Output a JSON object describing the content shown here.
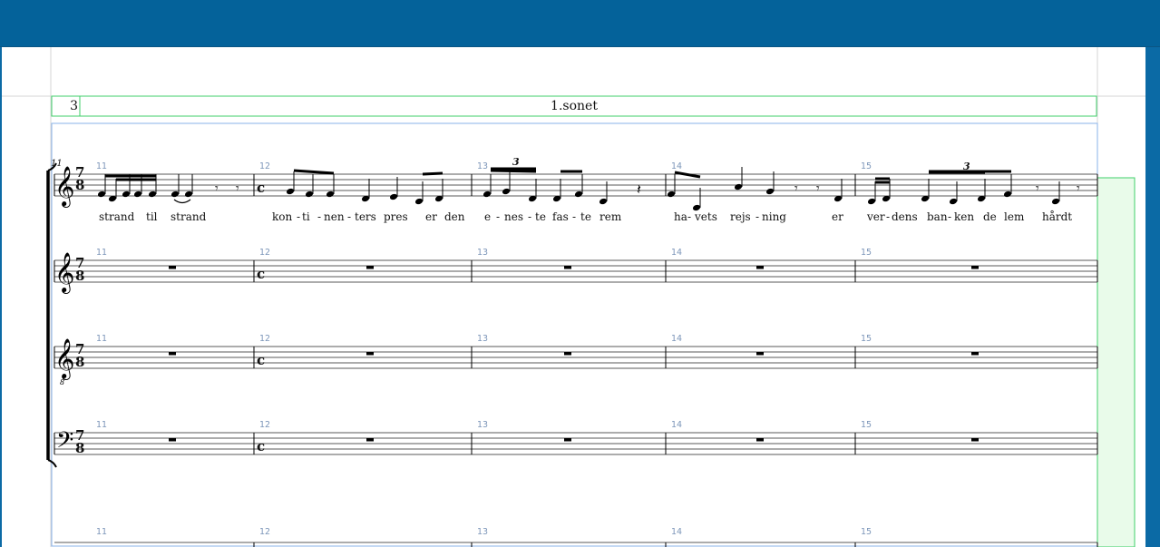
{
  "page_header": {
    "page_number": "3",
    "title": "1.sonet"
  },
  "system_start_number": "11",
  "measure_numbers": [
    "11",
    "12",
    "13",
    "14",
    "15"
  ],
  "time_signatures": {
    "first": {
      "num": "7",
      "den": "8"
    },
    "second": "c"
  },
  "tuplet_label": "3",
  "lyrics": {
    "m11": [
      "strand",
      "til",
      "strand"
    ],
    "m12": [
      "kon",
      "-",
      "ti",
      "-",
      "nen",
      "-",
      "ters",
      "pres",
      "er",
      "den"
    ],
    "m13": [
      "e",
      "-",
      "nes",
      "-",
      "te",
      "fas",
      "-",
      "te",
      "rem"
    ],
    "m14": [
      "ha",
      "-",
      "vets",
      "rejs",
      "-",
      "ning"
    ],
    "m15": [
      "er",
      "ver",
      "-",
      "dens",
      "ban",
      "-",
      "ken",
      "de",
      "lem",
      "hårdt"
    ]
  },
  "staves": [
    {
      "name": "voice",
      "clef": "treble"
    },
    {
      "name": "staff-2",
      "clef": "treble"
    },
    {
      "name": "staff-3",
      "clef": "treble-8vb"
    },
    {
      "name": "staff-4",
      "clef": "bass"
    }
  ],
  "colors": {
    "titlebar": "#04629a",
    "frame_green": "#3fcf6a",
    "frame_blue": "#6f9fe0",
    "measure_number": "#7c96b9"
  }
}
